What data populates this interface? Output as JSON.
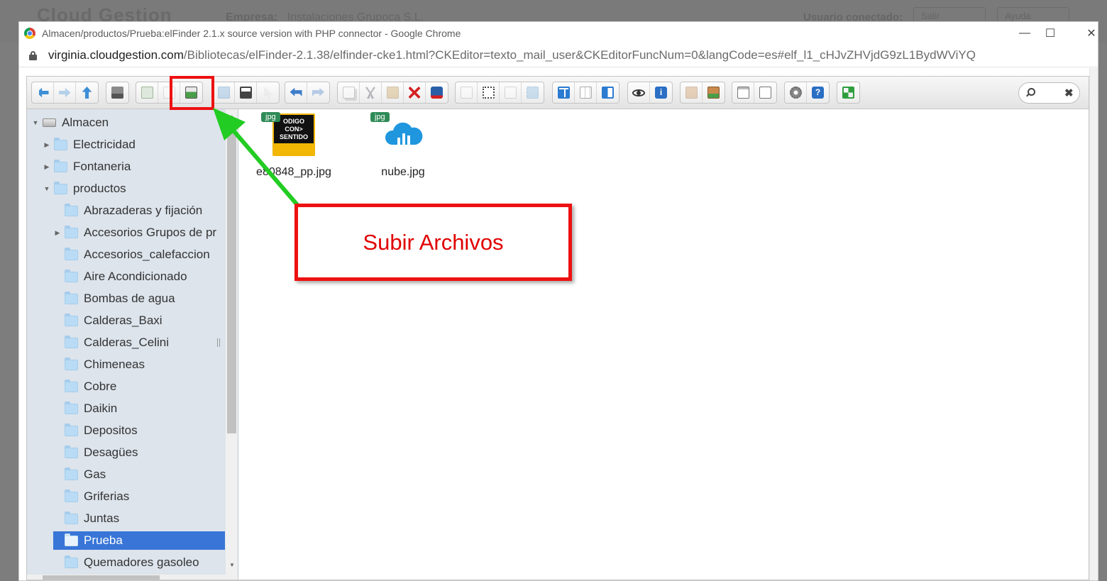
{
  "backdrop": {
    "logo": "Cloud Gestion",
    "company_label": "Empresa:",
    "company_value": "Instalaciones Grupoca S.L.",
    "user_label": "Usuario conectado:",
    "btn1": "Salir",
    "btn2": "Ayuda"
  },
  "window": {
    "title": "Almacen/productos/Prueba:elFinder 2.1.x source version with PHP connector - Google Chrome",
    "url_host": "virginia.cloudgestion.com",
    "url_path": "/Bibliotecas/elFinder-2.1.38/elfinder-cke1.html?CKEditor=texto_mail_user&CKEditorFuncNum=0&langCode=es#elf_l1_cHJvZHVjdG9zL1BydWViYQ",
    "minimize_icon": "minimize-icon",
    "maximize_icon": "maximize-icon",
    "close_icon": "close-icon"
  },
  "toolbar": {
    "groups": [
      [
        "back-icon",
        "forward-icon",
        "up-icon"
      ],
      [
        "home-icon"
      ],
      [
        "mkdir-icon",
        "mkfile-icon",
        "upload-icon"
      ],
      [
        "open-icon",
        "download-icon",
        "getfile-icon"
      ],
      [
        "undo-icon",
        "redo-icon"
      ],
      [
        "copy-icon",
        "cut-icon",
        "paste-icon",
        "delete-icon",
        "empty-icon"
      ],
      [
        "duplicate-icon",
        "rename-icon",
        "edit-icon",
        "resize-icon"
      ],
      [
        "view-icons-icon",
        "view-list-icon",
        "view-details-icon"
      ],
      [
        "quicklook-icon",
        "info-icon"
      ],
      [
        "extract-icon",
        "archive-icon"
      ],
      [
        "select-icon",
        "sort-icon"
      ],
      [
        "preferences-icon",
        "help-icon"
      ],
      [
        "fullscreen-icon"
      ]
    ]
  },
  "tree": {
    "root": "Almacen",
    "items": [
      {
        "label": "Electricidad",
        "level": 1,
        "expandable": true
      },
      {
        "label": "Fontaneria",
        "level": 1,
        "expandable": true
      },
      {
        "label": "productos",
        "level": 1,
        "expanded": true
      },
      {
        "label": "Abrazaderas y fijación",
        "level": 2
      },
      {
        "label": "Accesorios Grupos de pr",
        "level": 2,
        "expandable": true
      },
      {
        "label": "Accesorios_calefaccion",
        "level": 2
      },
      {
        "label": "Aire Acondicionado",
        "level": 2
      },
      {
        "label": "Bombas de agua",
        "level": 2
      },
      {
        "label": "Calderas_Baxi",
        "level": 2
      },
      {
        "label": "Calderas_Celini",
        "level": 2
      },
      {
        "label": "Chimeneas",
        "level": 2
      },
      {
        "label": "Cobre",
        "level": 2
      },
      {
        "label": "Daikin",
        "level": 2
      },
      {
        "label": "Depositos",
        "level": 2
      },
      {
        "label": "Desagües",
        "level": 2
      },
      {
        "label": "Gas",
        "level": 2
      },
      {
        "label": "Griferias",
        "level": 2
      },
      {
        "label": "Juntas",
        "level": 2
      },
      {
        "label": "Prueba",
        "level": 2,
        "selected": true
      },
      {
        "label": "Quemadores gasoleo",
        "level": 2
      }
    ]
  },
  "files": [
    {
      "name": "e80848_pp.jpg",
      "type": "jpg",
      "logo_lines": [
        "ODIGO",
        "CON>",
        "SENTIDO"
      ]
    },
    {
      "name": "nube.jpg",
      "type": "jpg"
    }
  ],
  "annotation": {
    "label": "Subir Archivos",
    "color": "#ee1111",
    "arrow_color": "#22cc22"
  }
}
